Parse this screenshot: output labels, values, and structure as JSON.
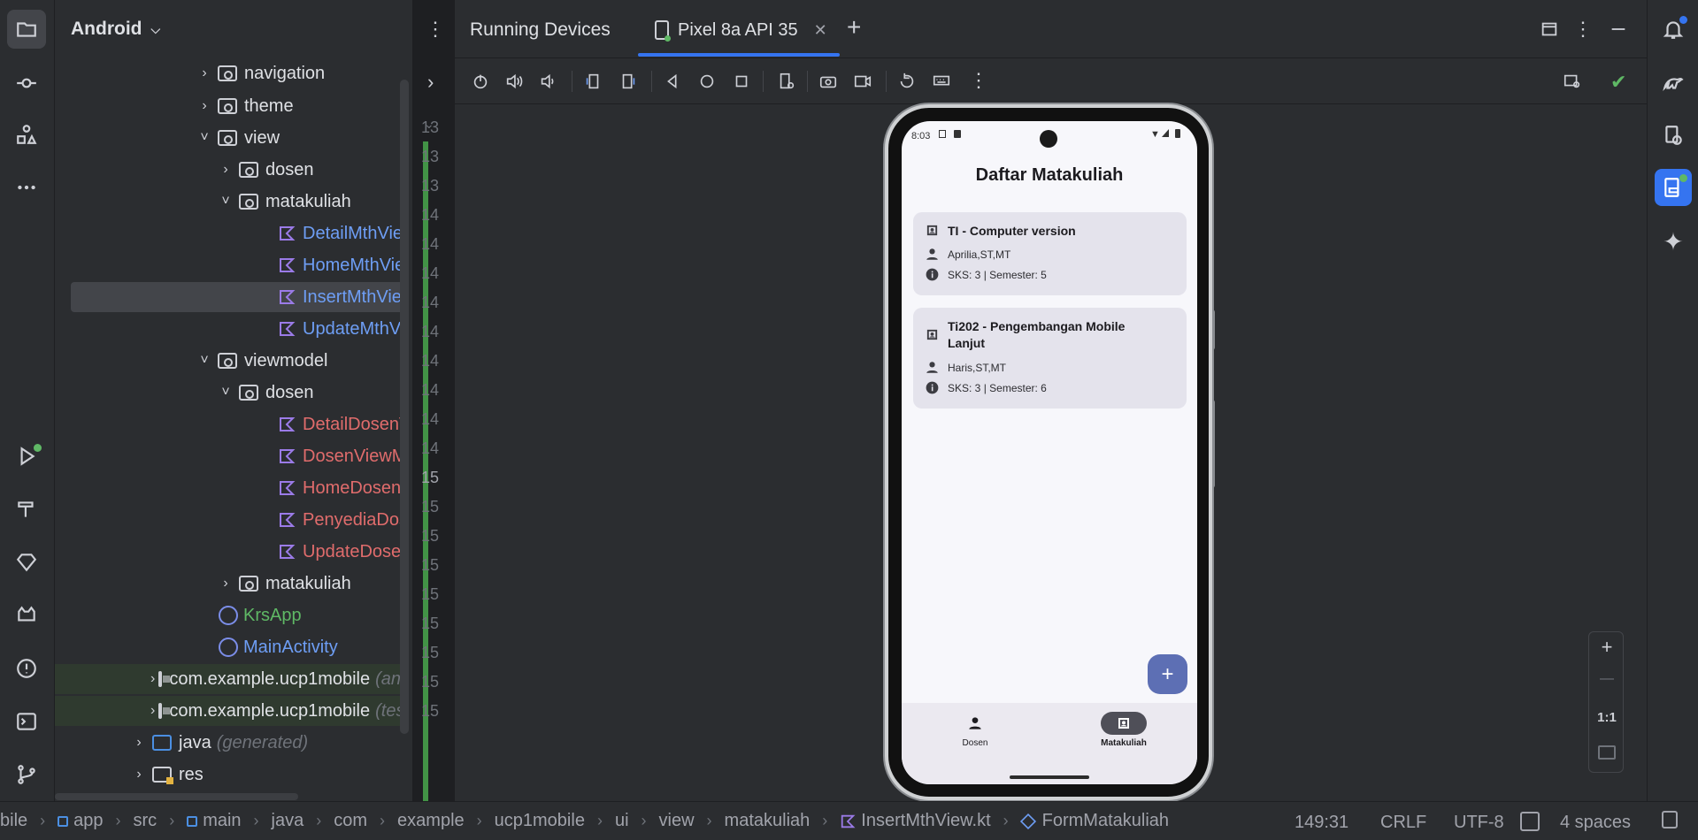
{
  "project_panel": {
    "title": "Android",
    "tree": [
      {
        "label": "navigation",
        "kind": "folder",
        "color": "#dfe1e5"
      },
      {
        "label": "theme",
        "kind": "folder",
        "color": "#dfe1e5"
      },
      {
        "label": "view",
        "kind": "folder",
        "color": "#dfe1e5"
      },
      {
        "label": "dosen",
        "kind": "folder",
        "color": "#dfe1e5"
      },
      {
        "label": "matakuliah",
        "kind": "folder",
        "color": "#dfe1e5"
      },
      {
        "label": "DetailMthView.kt",
        "kind": "kotlin",
        "color": "#6e9ef5"
      },
      {
        "label": "HomeMthView.kt",
        "kind": "kotlin",
        "color": "#6e9ef5"
      },
      {
        "label": "InsertMthView.kt",
        "kind": "kotlin",
        "color": "#6e9ef5"
      },
      {
        "label": "UpdateMthView.kt",
        "kind": "kotlin",
        "color": "#6e9ef5"
      },
      {
        "label": "viewmodel",
        "kind": "folder",
        "color": "#dfe1e5"
      },
      {
        "label": "dosen",
        "kind": "folder",
        "color": "#dfe1e5"
      },
      {
        "label": "DetailDosenViewModel",
        "kind": "kotlin",
        "color": "#e06c6c"
      },
      {
        "label": "DosenViewModel",
        "kind": "kotlin",
        "color": "#e06c6c"
      },
      {
        "label": "HomeDosenViewModel",
        "kind": "kotlin",
        "color": "#e06c6c"
      },
      {
        "label": "PenyediaDosenViewModel",
        "kind": "kotlin",
        "color": "#e06c6c"
      },
      {
        "label": "UpdateDosenViewModel",
        "kind": "kotlin",
        "color": "#e06c6c"
      },
      {
        "label": "matakuliah",
        "kind": "folder",
        "color": "#dfe1e5"
      },
      {
        "label": "KrsApp",
        "kind": "app",
        "color": "#5fb865"
      },
      {
        "label": "MainActivity",
        "kind": "app",
        "color": "#6e9ef5"
      },
      {
        "label": "com.example.ucp1mobile",
        "suffix": "(androidTest)",
        "kind": "package",
        "color": "#dfe1e5"
      },
      {
        "label": "com.example.ucp1mobile",
        "suffix": "(test)",
        "kind": "package",
        "color": "#dfe1e5"
      },
      {
        "label": "java",
        "suffix": "(generated)",
        "kind": "generated",
        "color": "#dfe1e5"
      },
      {
        "label": "res",
        "kind": "res",
        "color": "#dfe1e5"
      }
    ]
  },
  "gutter": {
    "lines": [
      "13",
      "13",
      "13",
      "14",
      "14",
      "14",
      "14",
      "14",
      "14",
      "14",
      "14",
      "14",
      "15",
      "15",
      "15",
      "15",
      "15",
      "15",
      "15",
      "15",
      "15"
    ],
    "current_index": 12,
    "current_line": "14"
  },
  "running_devices": {
    "title": "Running Devices",
    "tab_label": "Pixel 8a API 35"
  },
  "device": {
    "status_time": "8:03",
    "app_title": "Daftar Matakuliah",
    "cards": [
      {
        "title": "TI - Computer version",
        "dosen": "Aprilia,ST,MT",
        "info": "SKS: 3 | Semester: 5"
      },
      {
        "title": "Ti202 - Pengembangan Mobile Lanjut",
        "dosen": "Haris,ST,MT",
        "info": "SKS: 3 | Semester: 6"
      }
    ],
    "fab_label": "+",
    "nav": [
      {
        "label": "Dosen",
        "selected": false
      },
      {
        "label": "Matakuliah",
        "selected": true
      }
    ]
  },
  "zoom": {
    "plus": "+",
    "minus": "—",
    "one_to_one": "1:1"
  },
  "breadcrumb": [
    "bile",
    "app",
    "src",
    "main",
    "java",
    "com",
    "example",
    "ucp1mobile",
    "ui",
    "view",
    "matakuliah",
    "InsertMthView.kt",
    "FormMatakuliah"
  ],
  "status": {
    "position": "149:31",
    "line_sep": "CRLF",
    "encoding": "UTF-8",
    "indent": "4 spaces"
  },
  "colors": {
    "accent": "#3574f0",
    "vcs_added": "#49a84c",
    "kotlin_modified": "#6e9ef5",
    "kotlin_unversioned": "#e06c6c"
  }
}
